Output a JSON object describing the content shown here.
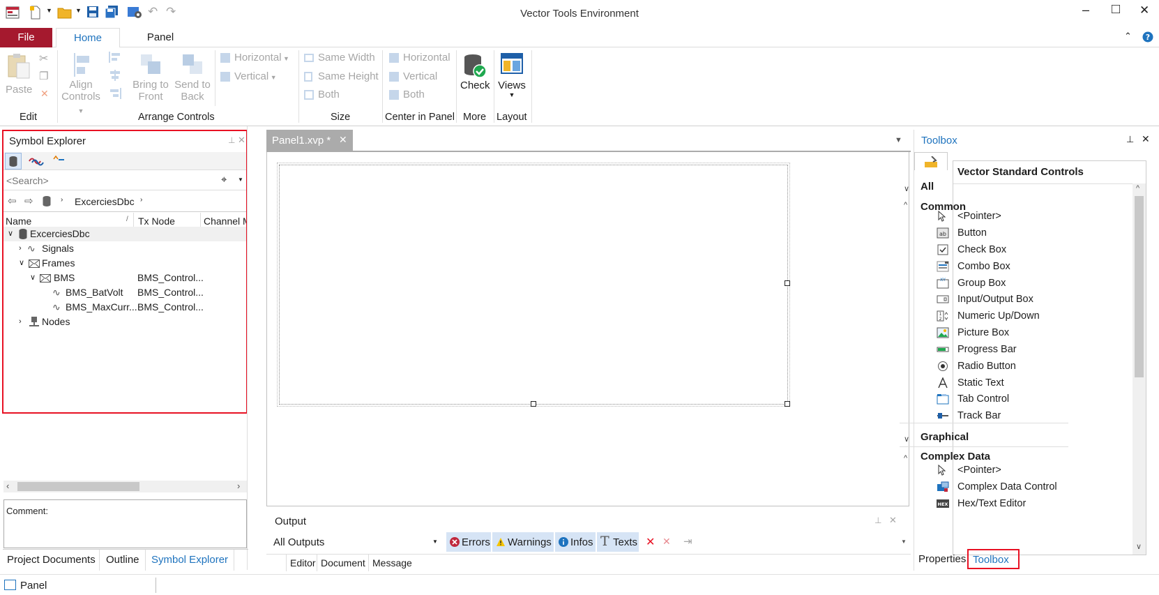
{
  "window": {
    "title": "Vector Tools Environment",
    "controls": {
      "minimize": "–",
      "maximize": "□",
      "close": "✕"
    }
  },
  "ribbon": {
    "tabs": {
      "file": "File",
      "home": "Home",
      "panel": "Panel"
    },
    "edit": {
      "paste": "Paste",
      "group": "Edit"
    },
    "arrange": {
      "align": "Align",
      "controls": "Controls",
      "bring_to": "Bring to",
      "front": "Front",
      "send_to": "Send to",
      "back": "Back",
      "horizontal": "Horizontal",
      "vertical": "Vertical",
      "group": "Arrange Controls"
    },
    "size": {
      "same_width": "Same Width",
      "same_height": "Same Height",
      "both": "Both",
      "group": "Size"
    },
    "center": {
      "horizontal": "Horizontal",
      "vertical": "Vertical",
      "both": "Both",
      "group": "Center in Panel"
    },
    "more": {
      "check": "Check",
      "group": "More"
    },
    "layout": {
      "views": "Views",
      "group": "Layout"
    }
  },
  "symbol_explorer": {
    "title": "Symbol Explorer",
    "search_placeholder": "<Search>",
    "breadcrumb": "ExcerciesDbc",
    "columns": {
      "name": "Name",
      "tx_node": "Tx Node",
      "channel": "Channel M"
    },
    "tree": {
      "root": "ExcerciesDbc",
      "signals": "Signals",
      "frames": "Frames",
      "bms": {
        "name": "BMS",
        "tx": "BMS_Control..."
      },
      "batvolt": {
        "name": "BMS_BatVolt",
        "tx": "BMS_Control..."
      },
      "maxcurr": {
        "name": "BMS_MaxCurr...",
        "tx": "BMS_Control..."
      },
      "nodes": "Nodes"
    },
    "comment_label": "Comment:",
    "bottom_tabs": {
      "project": "Project Documents",
      "outline": "Outline",
      "symbol": "Symbol Explorer"
    }
  },
  "document": {
    "tab": "Panel1.xvp *"
  },
  "output": {
    "title": "Output",
    "filter": "All Outputs",
    "buttons": {
      "errors": "Errors",
      "warnings": "Warnings",
      "infos": "Infos",
      "texts": "Texts"
    },
    "columns": {
      "editor": "Editor",
      "document": "Document",
      "message": "Message"
    }
  },
  "toolbox": {
    "title": "Toolbox",
    "header": "Vector Standard Controls",
    "groups": {
      "all": "All",
      "common": "Common",
      "graphical": "Graphical",
      "complex": "Complex Data"
    },
    "common_items": {
      "pointer": "<Pointer>",
      "button": "Button",
      "check_box": "Check Box",
      "combo_box": "Combo Box",
      "group_box": "Group Box",
      "io_box": "Input/Output Box",
      "numeric": "Numeric Up/Down",
      "picture": "Picture Box",
      "progress": "Progress Bar",
      "radio": "Radio Button",
      "static_text": "Static Text",
      "tab_control": "Tab Control",
      "track_bar": "Track Bar"
    },
    "complex_items": {
      "pointer": "<Pointer>",
      "complex_control": "Complex Data Control",
      "hex_editor": "Hex/Text Editor"
    },
    "bottom_tabs": {
      "properties": "Properties",
      "toolbox": "Toolbox"
    }
  },
  "status_bar": {
    "panel": "Panel"
  },
  "colors": {
    "file_tab": "#a5192e",
    "accent": "#1e73be",
    "highlight_box": "#e81123"
  }
}
